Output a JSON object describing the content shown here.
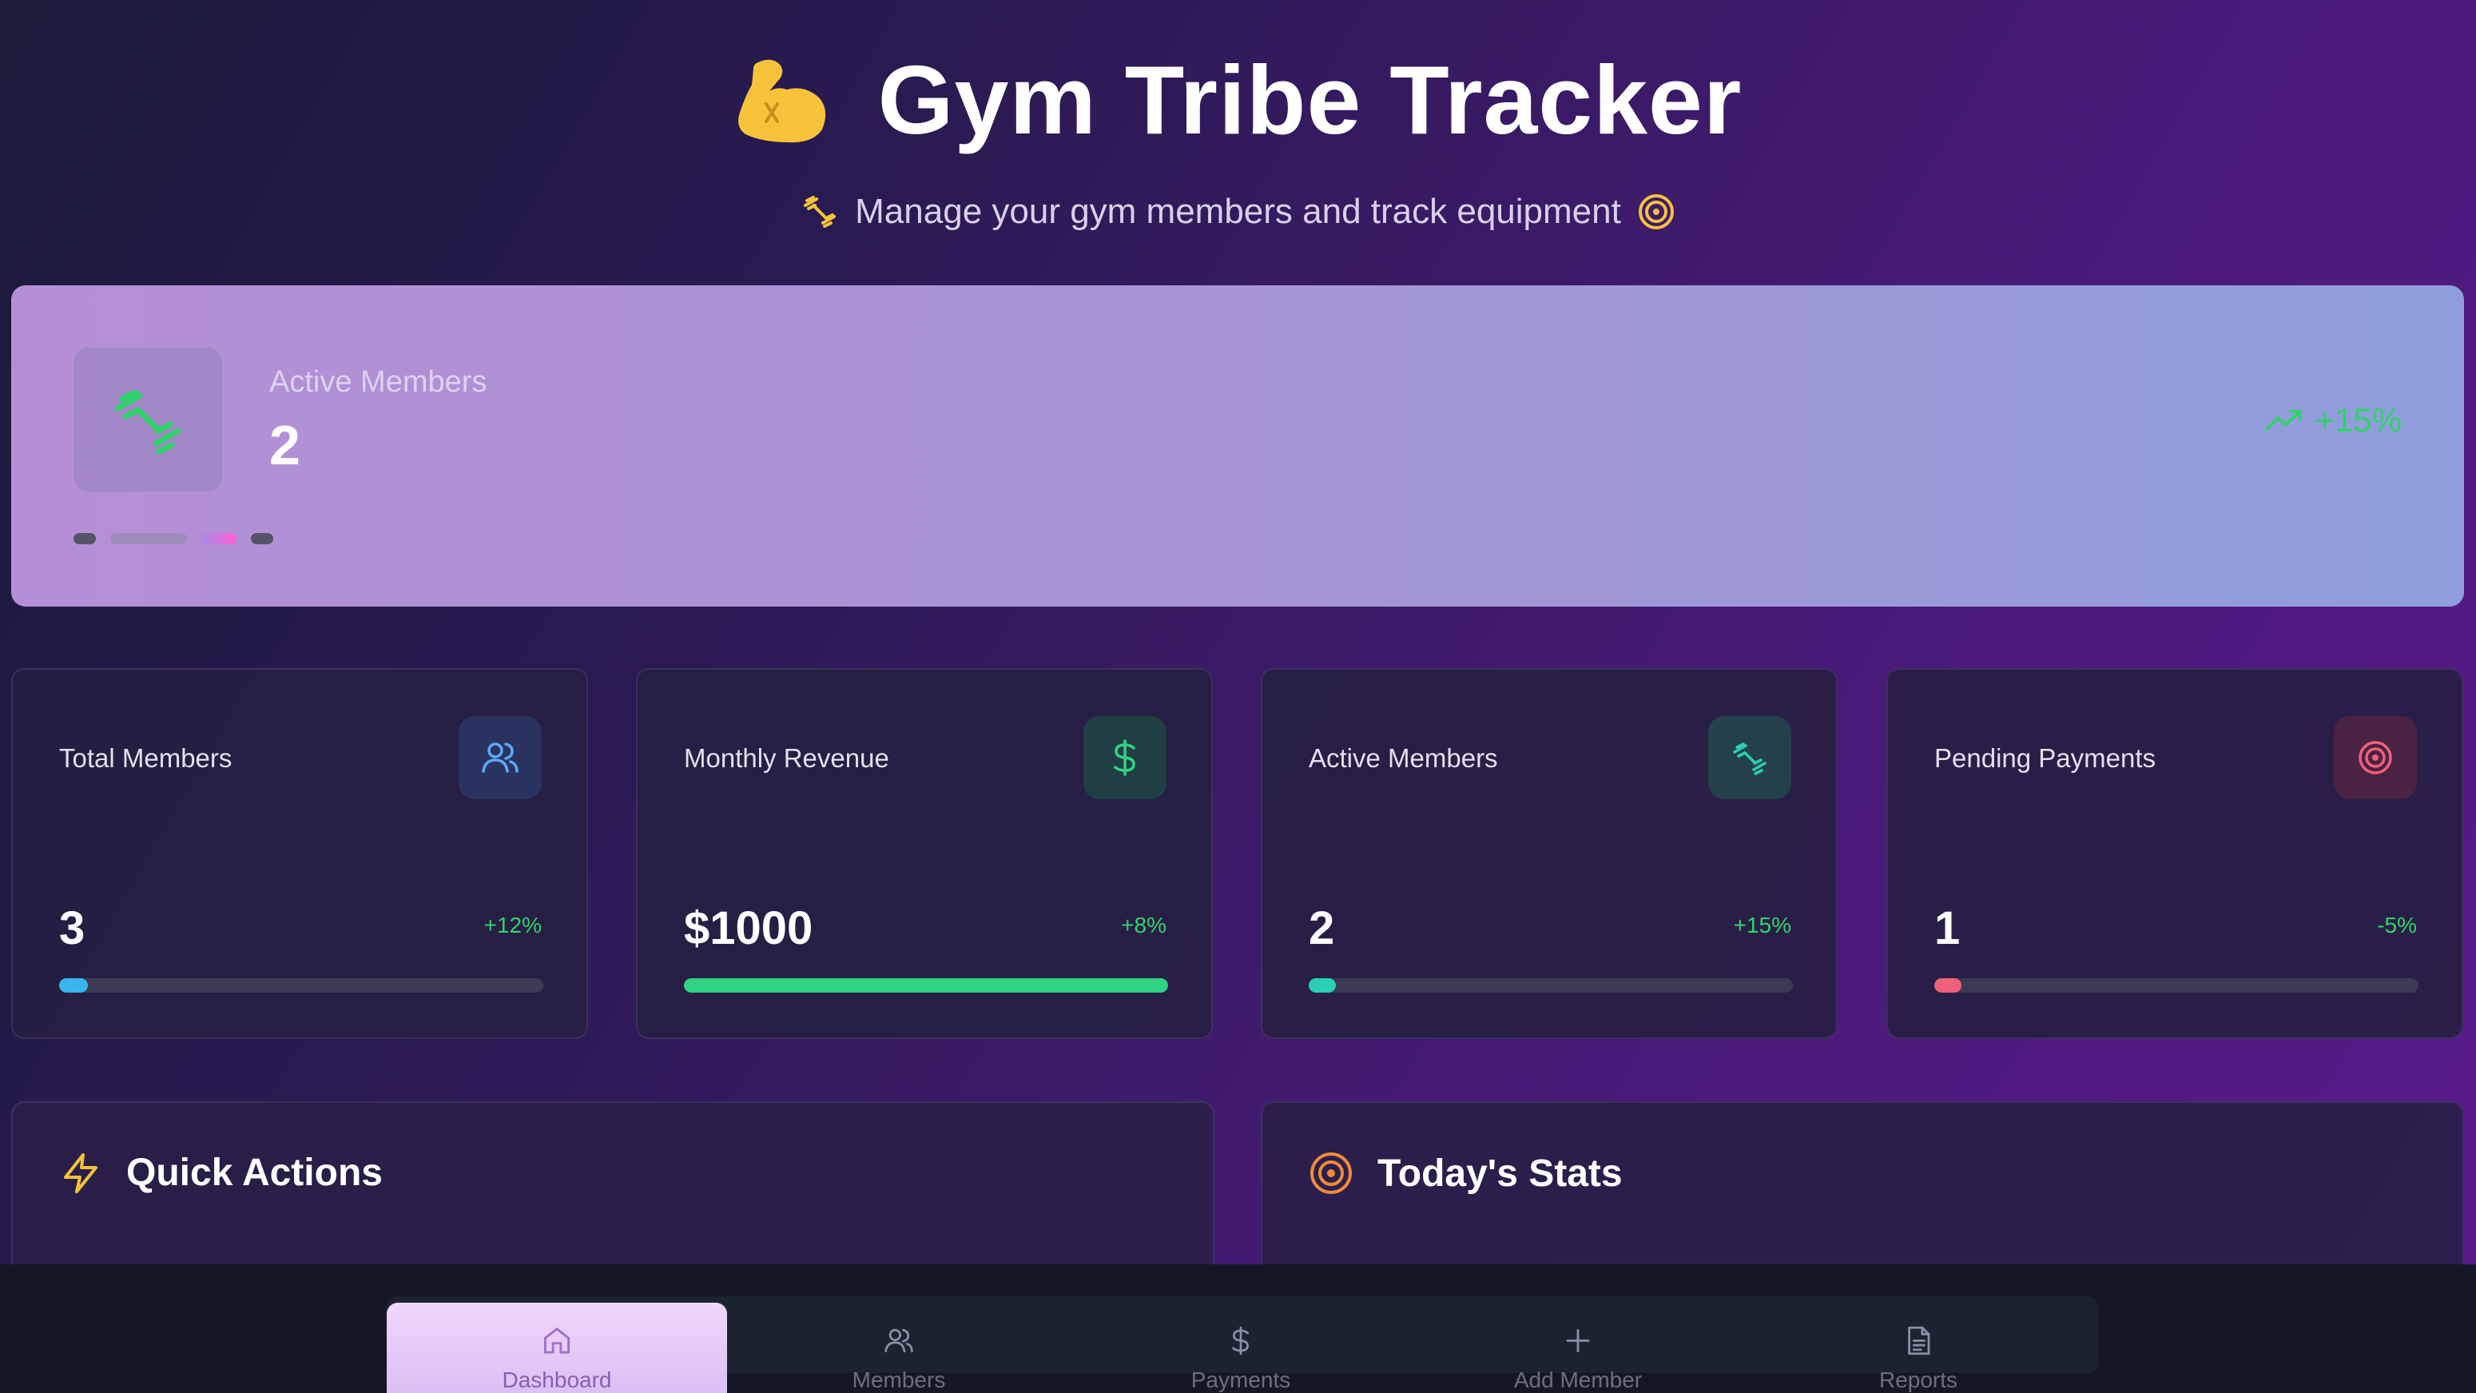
{
  "header": {
    "title": "Gym Tribe Tracker",
    "subtitle": "Manage your gym members and track equipment"
  },
  "hero": {
    "label": "Active Members",
    "value": "2",
    "trend": "+15%"
  },
  "stats": [
    {
      "label": "Total Members",
      "value": "3",
      "change": "+12%",
      "progress": 0.06,
      "icon": "users-icon",
      "color": "#38b6f0",
      "change_color": "#2fd36a"
    },
    {
      "label": "Monthly Revenue",
      "value": "$1000",
      "change": "+8%",
      "progress": 1.0,
      "icon": "dollar-icon",
      "color": "#2fd383",
      "change_color": "#2fd36a"
    },
    {
      "label": "Active Members",
      "value": "2",
      "change": "+15%",
      "progress": 0.04,
      "icon": "dumbbell-icon",
      "color": "#2ad0b5",
      "change_color": "#2fd36a"
    },
    {
      "label": "Pending Payments",
      "value": "1",
      "change": "-5%",
      "progress": 0.02,
      "icon": "target-icon",
      "color": "#f0607a",
      "change_color": "#2fd36a"
    }
  ],
  "sections": {
    "quick_actions": "Quick Actions",
    "todays_stats": "Today's Stats"
  },
  "nav": {
    "items": [
      {
        "label": "Dashboard",
        "icon": "home-icon",
        "active": true
      },
      {
        "label": "Members",
        "icon": "users-icon",
        "active": false
      },
      {
        "label": "Payments",
        "icon": "dollar-icon",
        "active": false
      },
      {
        "label": "Add Member",
        "icon": "plus-icon",
        "active": false
      },
      {
        "label": "Reports",
        "icon": "file-icon",
        "active": false
      }
    ]
  }
}
